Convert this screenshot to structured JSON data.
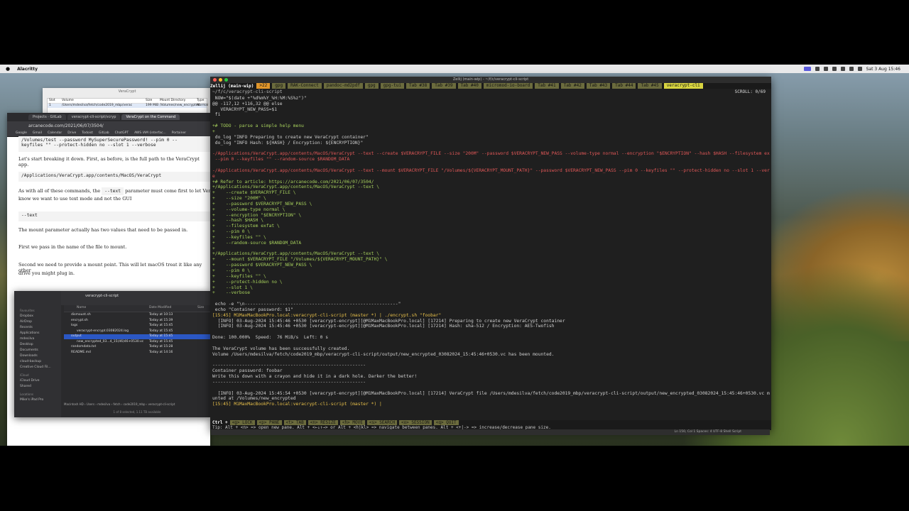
{
  "menubar": {
    "apple": "",
    "app": "Alacritty",
    "clock": "Sat 3 Aug 15:46"
  },
  "veracrypt_window": {
    "title": "VeraCrypt",
    "col_slot": "Slot",
    "col_volume": "Volume",
    "col_size": "Size",
    "col_mount": "Mount Directory",
    "col_type": "Type",
    "row_slot": "1",
    "row_volume": "/Users/mdesilva/fetch/code2019_mbp/verac",
    "row_size": "199 MiB",
    "row_mount": "/Volumes/new_encrypted",
    "row_type": "Normal"
  },
  "browser": {
    "tabs": [
      "Projects · GitLab",
      "veracrypt-cli-script/vcryp",
      "VeraCrypt on the Command"
    ],
    "url": "arcanecode.com/2021/06/07/3504/",
    "bookmarks": [
      "Google",
      "Gmail",
      "Calendar",
      "Drive",
      "Todoist",
      "GitLab",
      "ChatGPT",
      "AWS IAM (interfac...",
      "Portainer"
    ],
    "code_top_1": "/Volumes/test --password MySuperSecurePassword! --pim 0 --",
    "code_top_2": "keyfiles \"\" --protect-hidden no --slot 1 --verbose",
    "p1": "Let's start breaking it down. First, as before, is the full path to the VeraCrypt app.",
    "code_path": "/Applications/VeraCrypt.app/contents/MacOS/VeraCrypt",
    "p2a": "As with all of these commands, the",
    "p2_code": "--text",
    "p2b": "parameter must come first to let VeraCrypt",
    "p2c": "know we want to use text mode and not the GUI",
    "code_text": "--text",
    "p3": "The mount parameter actually has two values that need to be passed in.",
    "p4": "First we pass in the name of the file to mount.",
    "p5a": "Second we need to provide a mount point. This will let macOS treat it like any other",
    "p5b": "drive you might plug in."
  },
  "finder": {
    "title": "veracrypt-cli-script",
    "sidebar": [
      "Favourites",
      "Dropbox",
      "AirDrop",
      "Recents",
      "Applications",
      "mdesilva",
      "Desktop",
      "Documents",
      "Downloads",
      "cloud-backup",
      "Creative Cloud Fil...",
      "iCloud",
      "iCloud Drive",
      "Shared",
      "Locations",
      "Mike's iPad Pro"
    ],
    "col_name": "Name",
    "col_date": "Date Modified",
    "col_size": "Size",
    "rows": [
      {
        "name": "dismount.sh",
        "date": "Today at 10:13",
        "indent": 0,
        "sel": false
      },
      {
        "name": "encrypt.sh",
        "date": "Today at 15:39",
        "indent": 0,
        "sel": false
      },
      {
        "name": "logs",
        "date": "Today at 15:45",
        "indent": 0,
        "sel": false
      },
      {
        "name": "veracrypt-encrypt.03082024.log",
        "date": "Today at 15:45",
        "indent": 1,
        "sel": false
      },
      {
        "name": "output",
        "date": "Today at 15:45",
        "indent": 0,
        "sel": true
      },
      {
        "name": "new_encrypted_03...4_15(46)46+0530.vc",
        "date": "Today at 15:45",
        "indent": 1,
        "sel": false
      },
      {
        "name": "randomdata.txt",
        "date": "Today at 15:28",
        "indent": 0,
        "sel": false
      },
      {
        "name": "README.md",
        "date": "Today at 14:16",
        "indent": 0,
        "sel": false
      }
    ],
    "path": "Macintosh HD › Users › mdesilva › fetch › code2019_mbp › veracrypt-cli-script",
    "status": "1 of 8 selected, 1.11 TB available"
  },
  "terminal": {
    "title": "Zellij (main-wip) - ~/f/c/veracrypt-cli-script",
    "tabs": [
      "Zellij (main-wip)",
      ">22",
      "gpg",
      "RAK-Connect",
      "pandoc-md2pdf",
      "gpg",
      "gpg-tui",
      "Tab #38",
      "Tab #39",
      "Tab #40",
      "micromod-io-board",
      "Tab #41",
      "Tab #42",
      "Tab #43",
      "Tab #44",
      "Tab #45",
      "veracrypt-cli"
    ],
    "path": "~/f/c/veracrypt-cli-script",
    "scroll": "SCROLL:  0/69",
    "lines": [
      {
        "c": "",
        "t": ""
      },
      {
        "c": "",
        "t": " NOW=\"$(date +\"%d%m%Y_%H:%M:%S%z\")\""
      },
      {
        "c": "",
        "t": "@@ -117,12 +116,32 @@ else"
      },
      {
        "c": "",
        "t": "   VERACRYPT_NEW_PASS=$1"
      },
      {
        "c": "",
        "t": " fi"
      },
      {
        "c": "",
        "t": ""
      },
      {
        "c": "green",
        "t": "+# TODO - parse a simple help menu"
      },
      {
        "c": "green",
        "t": "+"
      },
      {
        "c": "",
        "t": " do_log \"INFO Preparing to create new VeraCrypt container\""
      },
      {
        "c": "",
        "t": " do_log \"INFO Hash: ${HASH} / Encryption: ${ENCRYPTION}\""
      },
      {
        "c": "",
        "t": ""
      },
      {
        "c": "red",
        "t": "-/Applications/VeraCrypt.app/contents/MacOS/VeraCrypt --text --create $VERACRYPT_FILE --size \"200M\" --password $VERACRYPT_NEW_PASS --volume-type normal --encryption \"$ENCRYPTION\" --hash $HASH --filesystem exfat"
      },
      {
        "c": "red",
        "t": " --pim 0 --keyfiles \"\" --random-source $RANDOM_DATA"
      },
      {
        "c": "",
        "t": ""
      },
      {
        "c": "red",
        "t": "-/Applications/VeraCrypt.app/contents/MacOS/VeraCrypt --text --mount $VERACRYPT_FILE \"/Volumes/${VERACRYPT_MOUNT_PATH}\" --password $VERACRYPT_NEW_PASS --pim 0 --keyfiles \"\" --protect-hidden no --slot 1 --verbos"
      },
      {
        "c": "red",
        "t": "e"
      },
      {
        "c": "green",
        "t": "+# Refer to article: https://arcanecode.com/2021/06/07/3504/"
      },
      {
        "c": "green",
        "t": "+/Applications/VeraCrypt.app/contents/MacOS/VeraCrypt --text \\"
      },
      {
        "c": "green",
        "t": "+    --create $VERACRYPT_FILE \\"
      },
      {
        "c": "green",
        "t": "+    --size \"200M\" \\"
      },
      {
        "c": "green",
        "t": "+    --password $VERACRYPT_NEW_PASS \\"
      },
      {
        "c": "green",
        "t": "+    --volume-type normal \\"
      },
      {
        "c": "green",
        "t": "+    --encryption \"$ENCRYPTION\" \\"
      },
      {
        "c": "green",
        "t": "+    --hash $HASH \\"
      },
      {
        "c": "green",
        "t": "+    --filesystem exfat \\"
      },
      {
        "c": "green",
        "t": "+    --pim 0 \\"
      },
      {
        "c": "green",
        "t": "+    --keyfiles \"\" \\"
      },
      {
        "c": "green",
        "t": "+    --random-source $RANDOM_DATA"
      },
      {
        "c": "green",
        "t": "+"
      },
      {
        "c": "green",
        "t": "+/Applications/VeraCrypt.app/contents/MacOS/VeraCrypt --text \\"
      },
      {
        "c": "green",
        "t": "+    --mount $VERACRYPT_FILE \"/Volumes/${VERACRYPT_MOUNT_PATH}\" \\"
      },
      {
        "c": "green",
        "t": "+    --password $VERACRYPT_NEW_PASS \\"
      },
      {
        "c": "green",
        "t": "+    --pim 0 \\"
      },
      {
        "c": "green",
        "t": "+    --keyfiles \"\" \\"
      },
      {
        "c": "green",
        "t": "+    --protect-hidden no \\"
      },
      {
        "c": "green",
        "t": "+    --slot 1 \\"
      },
      {
        "c": "green",
        "t": "+    --verbose"
      },
      {
        "c": "",
        "t": ""
      },
      {
        "c": "",
        "t": " echo -e \"\\n---------------------------------------------------------\""
      },
      {
        "c": "",
        "t": " echo \"Container password: $1\""
      },
      {
        "c": "yel",
        "t": "[15:45] M1MaxMacBookPro.local:veracrypt-cli-script (master *) | ./encrypt.sh \"foobar\""
      },
      {
        "c": "",
        "t": "  [INFO] 03-Aug-2024 15:45:46 +0530 [veracrypt-encrypt][@M1MaxMacBookPro.local] [17214] Preparing to create new VeraCrypt container"
      },
      {
        "c": "",
        "t": "  [INFO] 03-Aug-2024 15:45:46 +0530 [veracrypt-encrypt][@M1MaxMacBookPro.local] [17214] Hash: sha-512 / Encryption: AES-Twofish"
      },
      {
        "c": "",
        "t": ""
      },
      {
        "c": "",
        "t": "Done: 100.000%  Speed:  76 MiB/s  Left: 0 s"
      },
      {
        "c": "",
        "t": ""
      },
      {
        "c": "",
        "t": "The VeraCrypt volume has been successfully created."
      },
      {
        "c": "",
        "t": "Volume /Users/mdesilva/fetch/code2019_mbp/veracrypt-cli-script/output/new_encrypted_03082024_15:45:46+0530.vc has been mounted."
      },
      {
        "c": "",
        "t": ""
      },
      {
        "c": "",
        "t": "---------------------------------------------------------"
      },
      {
        "c": "",
        "t": "Container password: foobar"
      },
      {
        "c": "",
        "t": "Write this down with a crayon and hide it in a dark hole. Darker the better!"
      },
      {
        "c": "",
        "t": "---------------------------------------------------------"
      },
      {
        "c": "",
        "t": ""
      },
      {
        "c": "",
        "t": "  [INFO] 03-Aug-2024 15:45:54 +0530 [veracrypt-encrypt][@M1MaxMacBookPro.local] [17214] VeraCrypt file /Users/mdesilva/fetch/code2019_mbp/veracrypt-cli-script/output/new_encrypted_03082024_15:45:46+0530.vc mo"
      },
      {
        "c": "",
        "t": "unted at /Volumes/new_encrypted"
      },
      {
        "c": "yel",
        "t": "[15:45] M1MaxMacBookPro.local:veracrypt-cli-script (master *) | "
      }
    ],
    "status": {
      "ctrl": "Ctrl +",
      "keys": [
        "<g> LOCK",
        "<p> PANE",
        "<t> TAB",
        "<n> RESIZE",
        "<h> MOVE",
        "<s> SEARCH",
        "<o> SESSION",
        "<q> QUIT"
      ]
    },
    "tip": "Tip: Alt + <n> => open new pane. Alt + <←↓↑→> or Alt + <hjkl> => navigate between panes. Alt + <+|-> => increase/decrease pane size."
  },
  "editor_bar": {
    "left": "Ln 150, Col 1   Spaces: 4   UTF-8   Shell Script"
  }
}
